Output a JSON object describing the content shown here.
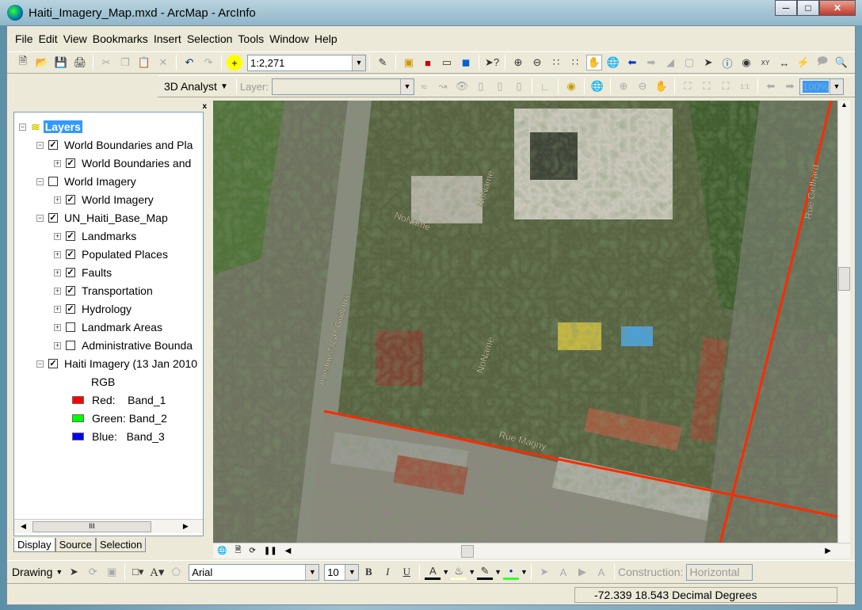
{
  "window": {
    "title": "Haiti_Imagery_Map.mxd - ArcMap - ArcInfo",
    "controls": [
      "minimize",
      "maximize",
      "close"
    ]
  },
  "menu": [
    "File",
    "Edit",
    "View",
    "Bookmarks",
    "Insert",
    "Selection",
    "Tools",
    "Window",
    "Help"
  ],
  "standard_toolbar": {
    "scale": "1:2,271"
  },
  "analyst_toolbar": {
    "label": "3D Analyst",
    "layer_label": "Layer:",
    "layer_value": "",
    "zoom_percent": "100%"
  },
  "toc": {
    "items": [
      {
        "label": "Layers",
        "level": 0,
        "expander": "minus",
        "checked": null,
        "selected": true
      },
      {
        "label": "World Boundaries and Pla",
        "level": 1,
        "expander": "minus",
        "checked": true
      },
      {
        "label": "World Boundaries and",
        "level": 2,
        "expander": "plus",
        "checked": true
      },
      {
        "label": "World Imagery",
        "level": 1,
        "expander": "minus",
        "checked": false
      },
      {
        "label": "World Imagery",
        "level": 2,
        "expander": "plus",
        "checked": true
      },
      {
        "label": "UN_Haiti_Base_Map",
        "level": 1,
        "expander": "minus",
        "checked": true
      },
      {
        "label": "Landmarks",
        "level": 2,
        "expander": "plus",
        "checked": true
      },
      {
        "label": "Populated Places",
        "level": 2,
        "expander": "plus",
        "checked": true
      },
      {
        "label": "Faults",
        "level": 2,
        "expander": "plus",
        "checked": true
      },
      {
        "label": "Transportation",
        "level": 2,
        "expander": "plus",
        "checked": true
      },
      {
        "label": "Hydrology",
        "level": 2,
        "expander": "plus",
        "checked": true
      },
      {
        "label": "Landmark Areas",
        "level": 2,
        "expander": "plus",
        "checked": false
      },
      {
        "label": "Administrative Bounda",
        "level": 2,
        "expander": "plus",
        "checked": false
      },
      {
        "label": "Haiti Imagery (13 Jan 2010",
        "level": 1,
        "expander": "minus",
        "checked": true
      }
    ],
    "rgb_label": "RGB",
    "bands": [
      {
        "label": "Red:    Band_1",
        "color": "#ff0000"
      },
      {
        "label": "Green: Band_2",
        "color": "#00ff00"
      },
      {
        "label": "Blue:   Band_3",
        "color": "#0000ff"
      }
    ],
    "tabs": [
      "Display",
      "Source",
      "Selection"
    ],
    "active_tab": "Display"
  },
  "map": {
    "labels": [
      "Avenue MGR Guilloux",
      "NoName",
      "NoName",
      "NoName",
      "Rue Magny",
      "Rue Geffrard"
    ],
    "road_color": "#ff2a00"
  },
  "drawing_toolbar": {
    "label": "Drawing",
    "font": "Arial",
    "size": "10",
    "construction_label": "Construction:",
    "construction_value": "Horizontal"
  },
  "status": {
    "coordinates": "-72.339  18.543 Decimal Degrees"
  }
}
